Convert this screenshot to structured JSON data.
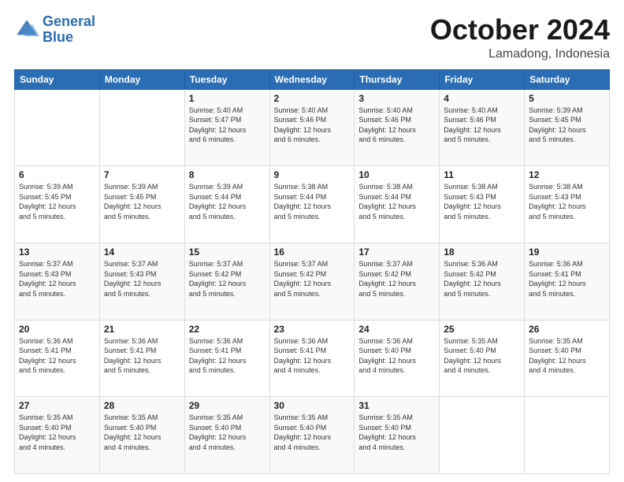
{
  "logo": {
    "line1": "General",
    "line2": "Blue"
  },
  "header": {
    "month": "October 2024",
    "location": "Lamadong, Indonesia"
  },
  "weekdays": [
    "Sunday",
    "Monday",
    "Tuesday",
    "Wednesday",
    "Thursday",
    "Friday",
    "Saturday"
  ],
  "weeks": [
    [
      {
        "day": "",
        "info": ""
      },
      {
        "day": "",
        "info": ""
      },
      {
        "day": "1",
        "info": "Sunrise: 5:40 AM\nSunset: 5:47 PM\nDaylight: 12 hours\nand 6 minutes."
      },
      {
        "day": "2",
        "info": "Sunrise: 5:40 AM\nSunset: 5:46 PM\nDaylight: 12 hours\nand 6 minutes."
      },
      {
        "day": "3",
        "info": "Sunrise: 5:40 AM\nSunset: 5:46 PM\nDaylight: 12 hours\nand 6 minutes."
      },
      {
        "day": "4",
        "info": "Sunrise: 5:40 AM\nSunset: 5:46 PM\nDaylight: 12 hours\nand 5 minutes."
      },
      {
        "day": "5",
        "info": "Sunrise: 5:39 AM\nSunset: 5:45 PM\nDaylight: 12 hours\nand 5 minutes."
      }
    ],
    [
      {
        "day": "6",
        "info": "Sunrise: 5:39 AM\nSunset: 5:45 PM\nDaylight: 12 hours\nand 5 minutes."
      },
      {
        "day": "7",
        "info": "Sunrise: 5:39 AM\nSunset: 5:45 PM\nDaylight: 12 hours\nand 5 minutes."
      },
      {
        "day": "8",
        "info": "Sunrise: 5:39 AM\nSunset: 5:44 PM\nDaylight: 12 hours\nand 5 minutes."
      },
      {
        "day": "9",
        "info": "Sunrise: 5:38 AM\nSunset: 5:44 PM\nDaylight: 12 hours\nand 5 minutes."
      },
      {
        "day": "10",
        "info": "Sunrise: 5:38 AM\nSunset: 5:44 PM\nDaylight: 12 hours\nand 5 minutes."
      },
      {
        "day": "11",
        "info": "Sunrise: 5:38 AM\nSunset: 5:43 PM\nDaylight: 12 hours\nand 5 minutes."
      },
      {
        "day": "12",
        "info": "Sunrise: 5:38 AM\nSunset: 5:43 PM\nDaylight: 12 hours\nand 5 minutes."
      }
    ],
    [
      {
        "day": "13",
        "info": "Sunrise: 5:37 AM\nSunset: 5:43 PM\nDaylight: 12 hours\nand 5 minutes."
      },
      {
        "day": "14",
        "info": "Sunrise: 5:37 AM\nSunset: 5:43 PM\nDaylight: 12 hours\nand 5 minutes."
      },
      {
        "day": "15",
        "info": "Sunrise: 5:37 AM\nSunset: 5:42 PM\nDaylight: 12 hours\nand 5 minutes."
      },
      {
        "day": "16",
        "info": "Sunrise: 5:37 AM\nSunset: 5:42 PM\nDaylight: 12 hours\nand 5 minutes."
      },
      {
        "day": "17",
        "info": "Sunrise: 5:37 AM\nSunset: 5:42 PM\nDaylight: 12 hours\nand 5 minutes."
      },
      {
        "day": "18",
        "info": "Sunrise: 5:36 AM\nSunset: 5:42 PM\nDaylight: 12 hours\nand 5 minutes."
      },
      {
        "day": "19",
        "info": "Sunrise: 5:36 AM\nSunset: 5:41 PM\nDaylight: 12 hours\nand 5 minutes."
      }
    ],
    [
      {
        "day": "20",
        "info": "Sunrise: 5:36 AM\nSunset: 5:41 PM\nDaylight: 12 hours\nand 5 minutes."
      },
      {
        "day": "21",
        "info": "Sunrise: 5:36 AM\nSunset: 5:41 PM\nDaylight: 12 hours\nand 5 minutes."
      },
      {
        "day": "22",
        "info": "Sunrise: 5:36 AM\nSunset: 5:41 PM\nDaylight: 12 hours\nand 5 minutes."
      },
      {
        "day": "23",
        "info": "Sunrise: 5:36 AM\nSunset: 5:41 PM\nDaylight: 12 hours\nand 4 minutes."
      },
      {
        "day": "24",
        "info": "Sunrise: 5:36 AM\nSunset: 5:40 PM\nDaylight: 12 hours\nand 4 minutes."
      },
      {
        "day": "25",
        "info": "Sunrise: 5:35 AM\nSunset: 5:40 PM\nDaylight: 12 hours\nand 4 minutes."
      },
      {
        "day": "26",
        "info": "Sunrise: 5:35 AM\nSunset: 5:40 PM\nDaylight: 12 hours\nand 4 minutes."
      }
    ],
    [
      {
        "day": "27",
        "info": "Sunrise: 5:35 AM\nSunset: 5:40 PM\nDaylight: 12 hours\nand 4 minutes."
      },
      {
        "day": "28",
        "info": "Sunrise: 5:35 AM\nSunset: 5:40 PM\nDaylight: 12 hours\nand 4 minutes."
      },
      {
        "day": "29",
        "info": "Sunrise: 5:35 AM\nSunset: 5:40 PM\nDaylight: 12 hours\nand 4 minutes."
      },
      {
        "day": "30",
        "info": "Sunrise: 5:35 AM\nSunset: 5:40 PM\nDaylight: 12 hours\nand 4 minutes."
      },
      {
        "day": "31",
        "info": "Sunrise: 5:35 AM\nSunset: 5:40 PM\nDaylight: 12 hours\nand 4 minutes."
      },
      {
        "day": "",
        "info": ""
      },
      {
        "day": "",
        "info": ""
      }
    ]
  ]
}
